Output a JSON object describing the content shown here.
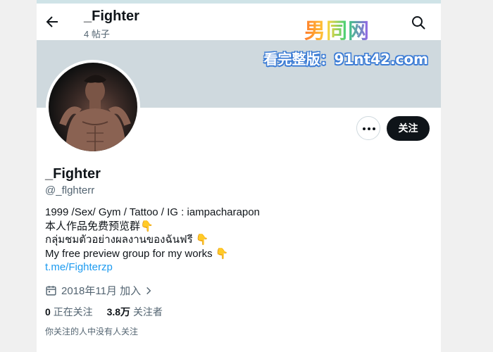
{
  "header": {
    "title": "_Fighter",
    "post_count": "4 帖子",
    "watermark_logo": "男同网"
  },
  "banner": {
    "watermark_url": "看完整版：91nt42.com"
  },
  "actions": {
    "follow_label": "关注"
  },
  "profile": {
    "name": "_Fighter",
    "handle": "@_flghterr",
    "bio_lines": [
      "1999 /Sex/ Gym / Tattoo  / IG : iampacharapon",
      "本人作品免费预览群👇",
      "กลุ่มชมตัวอย่างผลงานของฉันฟรี 👇",
      "My free preview group for my works 👇"
    ],
    "link": "t.me/Fighterzp",
    "joined": "2018年11月 加入"
  },
  "stats": {
    "following_count": "0",
    "following_label": "正在关注",
    "followers_count": "3.8万",
    "followers_label": "关注者"
  },
  "note": "你关注的人中没有人关注",
  "colors": {
    "banner": "#cfd9de",
    "follow_button": "#0f1419",
    "link": "#1d9bf0",
    "secondary_text": "#536471"
  }
}
